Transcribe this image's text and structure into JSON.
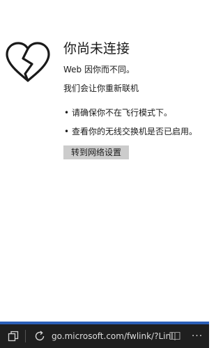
{
  "error": {
    "title": "你尚未连接",
    "subtitle": "Web 因你而不同。",
    "hint": "我们会让你重新联机",
    "bullets": [
      "请确保你不在飞行模式下。",
      "查看你的无线交换机是否已启用。"
    ],
    "bullet_glyph": "•",
    "settings_button": "转到网络设置"
  },
  "addressbar": {
    "url": "go.microsoft.com/fwlink/?LinI",
    "more_glyph": "···",
    "accent_color": "#2b5fb8",
    "background_color": "#1f1f1f"
  },
  "icons": [
    "broken-heart-icon",
    "tabs-icon",
    "refresh-icon",
    "reading-view-icon",
    "more-icon"
  ]
}
